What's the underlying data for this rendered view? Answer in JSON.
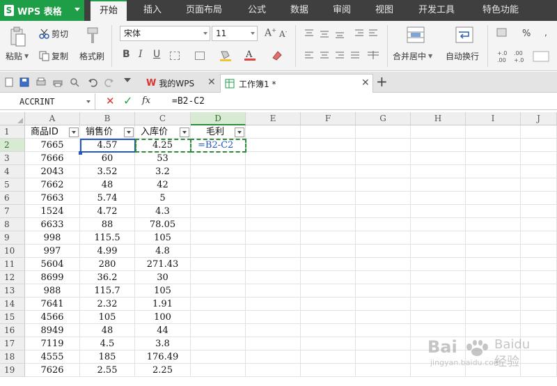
{
  "app": {
    "name": "WPS 表格"
  },
  "menu": [
    "开始",
    "插入",
    "页面布局",
    "公式",
    "数据",
    "审阅",
    "视图",
    "开发工具",
    "特色功能"
  ],
  "ribbon": {
    "cut": "剪切",
    "paste": "粘贴",
    "copy": "复制",
    "format_painter": "格式刷",
    "font_name": "宋体",
    "font_size": "11",
    "merge_center": "合并居中",
    "wrap_text": "自动换行"
  },
  "tabs": {
    "home": "我的WPS",
    "book": "工作簿1 *"
  },
  "formula_bar": {
    "name_box": "ACCRINT",
    "formula": "=B2-C2"
  },
  "columns": [
    "A",
    "B",
    "C",
    "D",
    "E",
    "F",
    "G",
    "H",
    "I",
    "J"
  ],
  "headers": [
    "商品ID",
    "销售价",
    "入库价",
    "毛利"
  ],
  "rows": [
    [
      "1",
      "7665",
      "4.57",
      "4.25",
      "=B2-C2"
    ],
    [
      "2",
      "7666",
      "60",
      "53",
      ""
    ],
    [
      "3",
      "2043",
      "3.52",
      "3.2",
      ""
    ],
    [
      "4",
      "7662",
      "48",
      "42",
      ""
    ],
    [
      "5",
      "7663",
      "5.74",
      "5",
      ""
    ],
    [
      "6",
      "1524",
      "4.72",
      "4.3",
      ""
    ],
    [
      "7",
      "6633",
      "88",
      "78.05",
      ""
    ],
    [
      "8",
      "998",
      "115.5",
      "105",
      ""
    ],
    [
      "9",
      "997",
      "4.99",
      "4.8",
      ""
    ],
    [
      "10",
      "5604",
      "280",
      "271.43",
      ""
    ],
    [
      "11",
      "8699",
      "36.2",
      "30",
      ""
    ],
    [
      "12",
      "988",
      "115.7",
      "105",
      ""
    ],
    [
      "13",
      "7641",
      "2.32",
      "1.91",
      ""
    ],
    [
      "14",
      "4566",
      "105",
      "100",
      ""
    ],
    [
      "15",
      "8949",
      "48",
      "44",
      ""
    ],
    [
      "16",
      "7119",
      "4.5",
      "3.8",
      ""
    ],
    [
      "17",
      "4555",
      "185",
      "176.49",
      ""
    ],
    [
      "18",
      "7626",
      "2.55",
      "2.25",
      ""
    ]
  ],
  "row_numbers": [
    "1",
    "2",
    "3",
    "4",
    "5",
    "6",
    "7",
    "8",
    "9",
    "10",
    "11",
    "12",
    "13",
    "14",
    "15",
    "16",
    "17",
    "18",
    "19"
  ],
  "watermark": {
    "brand": "Baidu 经验",
    "url": "jingyan.baidu.com"
  },
  "colors": {
    "accent": "#1f9e48",
    "ref_b": "#2355c4",
    "ref_c": "#2c8b3c"
  }
}
